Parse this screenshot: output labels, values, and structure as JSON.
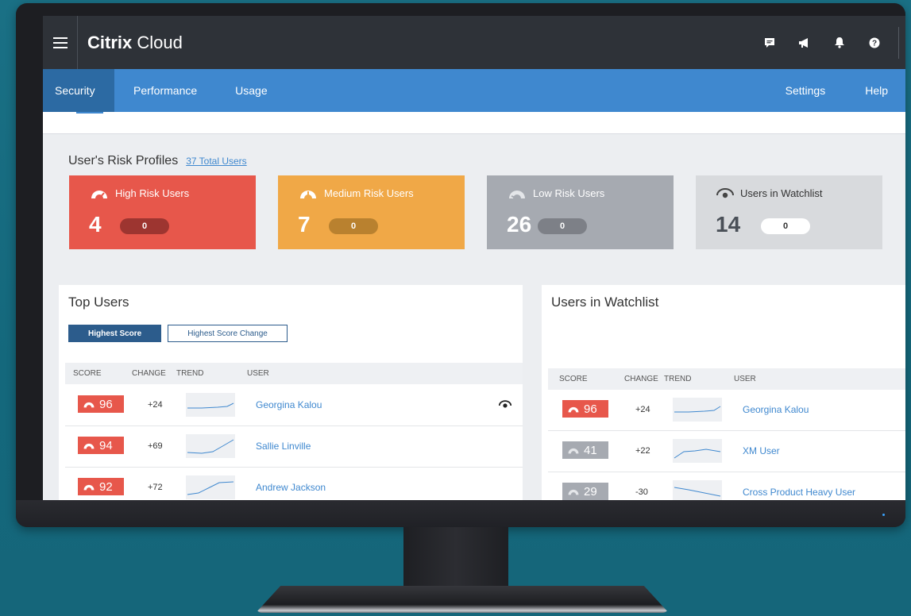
{
  "app": {
    "brand_bold": "Citrix",
    "brand_light": "Cloud"
  },
  "nav": {
    "tabs": [
      {
        "label": "Security",
        "active": true
      },
      {
        "label": "Performance",
        "active": false
      },
      {
        "label": "Usage",
        "active": false
      }
    ],
    "settings_label": "Settings",
    "help_label": "Help"
  },
  "risk": {
    "title": "User's Risk Profiles",
    "total_link": "37 Total Users",
    "cards": [
      {
        "label": "High Risk Users",
        "count": "4",
        "delta": "0",
        "color": "#e7574b"
      },
      {
        "label": "Medium Risk Users",
        "count": "7",
        "delta": "0",
        "color": "#f0a847"
      },
      {
        "label": "Low Risk Users",
        "count": "26",
        "delta": "0",
        "color": "#a6aab1"
      },
      {
        "label": "Users in Watchlist",
        "count": "14",
        "delta": "0",
        "color": "#d8dadd"
      }
    ]
  },
  "top_users": {
    "title": "Top Users",
    "btn_highest_score": "Highest Score",
    "btn_highest_change": "Highest Score Change",
    "columns": [
      "SCORE",
      "CHANGE",
      "TREND",
      "USER"
    ],
    "rows": [
      {
        "score": "96",
        "change": "+24",
        "user": "Georgina Kalou",
        "level": "high",
        "watched": true
      },
      {
        "score": "94",
        "change": "+69",
        "user": "Sallie Linville",
        "level": "high",
        "watched": false
      },
      {
        "score": "92",
        "change": "+72",
        "user": "Andrew Jackson",
        "level": "high",
        "watched": false
      }
    ]
  },
  "watchlist": {
    "title": "Users in Watchlist",
    "columns": [
      "SCORE",
      "CHANGE",
      "TREND",
      "USER"
    ],
    "rows": [
      {
        "score": "96",
        "change": "+24",
        "user": "Georgina Kalou",
        "level": "high"
      },
      {
        "score": "41",
        "change": "+22",
        "user": "XM User",
        "level": "low"
      },
      {
        "score": "29",
        "change": "-30",
        "user": "Cross Product Heavy User",
        "level": "low"
      }
    ]
  },
  "icons": {
    "menu": "hamburger-icon",
    "feedback": "feedback-icon",
    "announce": "megaphone-icon",
    "notifications": "bell-icon",
    "help": "help-icon",
    "risk_gauge": "gauge-icon",
    "watch": "eye-icon"
  },
  "colors": {
    "accent": "#3f88cf",
    "high": "#e7574b",
    "medium": "#f0a847",
    "low": "#a6aab1"
  }
}
